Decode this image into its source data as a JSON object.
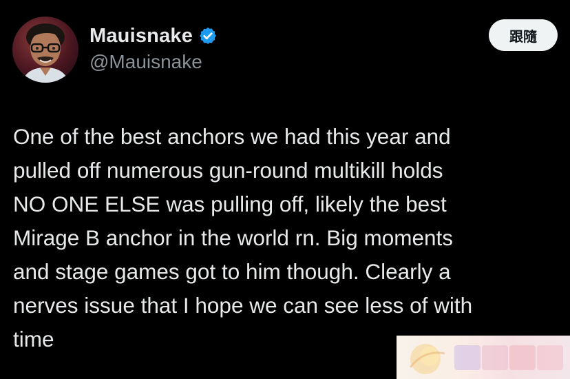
{
  "user": {
    "display_name": "Mauisnake",
    "handle": "@Mauisnake",
    "verified": true,
    "avatar_icon": "profile-photo"
  },
  "follow_button": {
    "label": "跟隨"
  },
  "tweet": {
    "text": "One of the best anchors we had this year and\npulled off numerous gun-round multikill holds\nNO ONE ELSE was pulling off, likely the best\nMirage B anchor in the world rn. Big moments\nand stage games got to him though. Clearly a\nnerves issue that I hope we can see less of with\ntime"
  },
  "colors": {
    "background": "#000000",
    "primary_text": "#e7e9ea",
    "secondary_text": "#8b9298",
    "verified_blue": "#1d9bf0",
    "follow_bg": "#eff3f4"
  },
  "watermark": {
    "icon": "watermark-logo"
  }
}
